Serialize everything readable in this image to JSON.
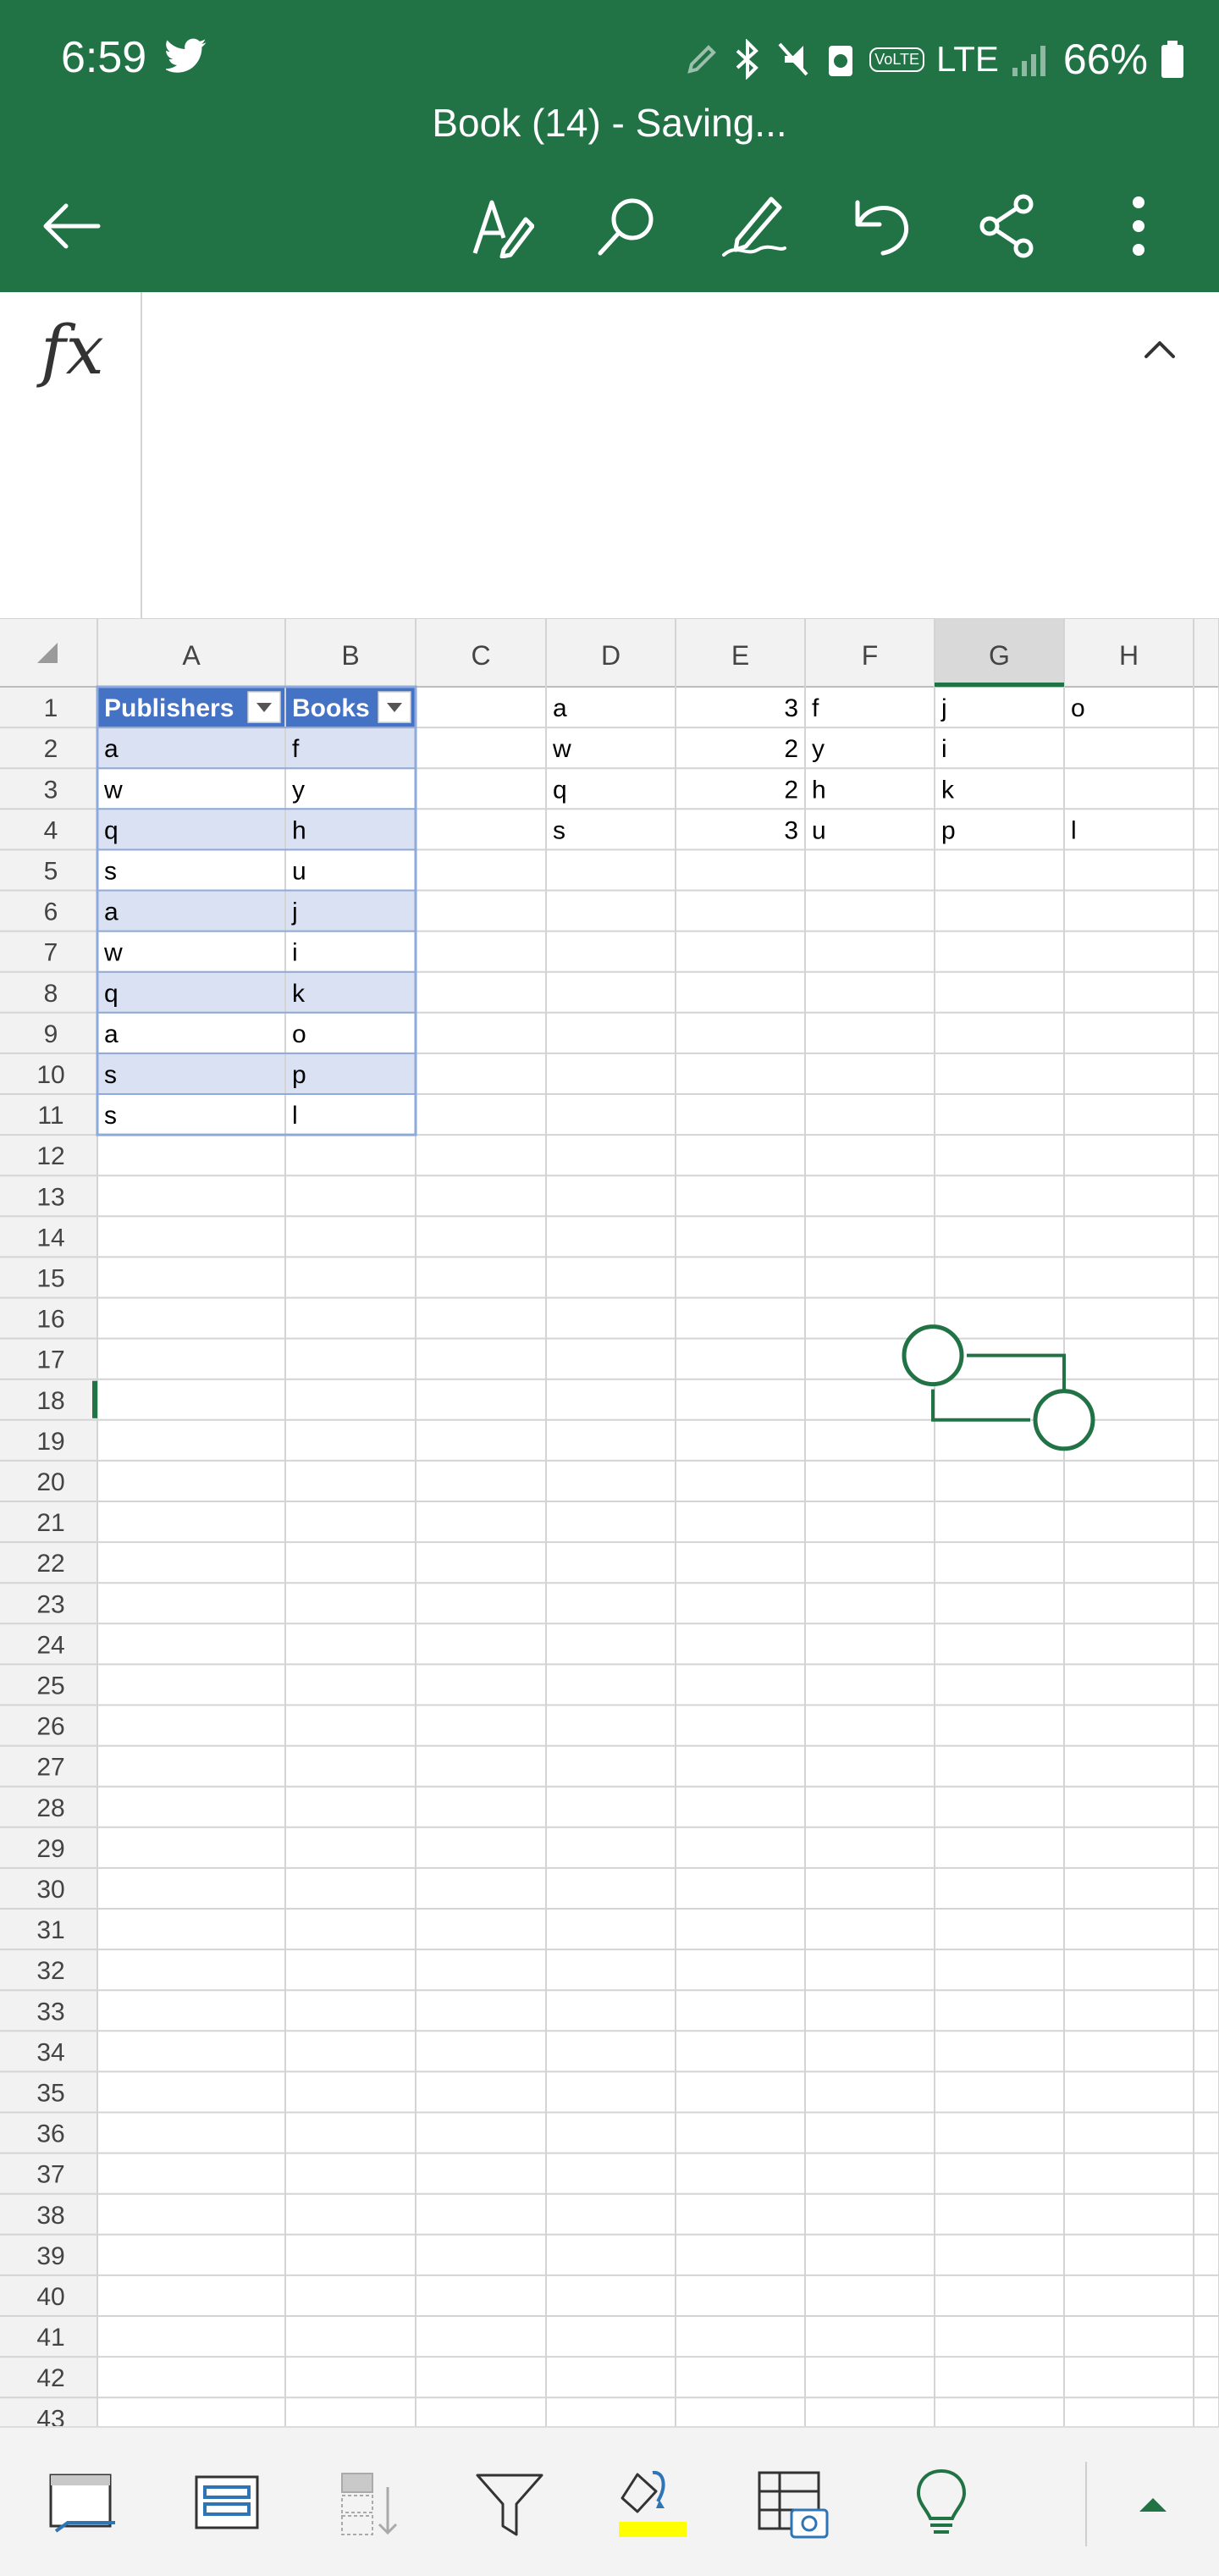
{
  "status": {
    "time": "6:59",
    "battery": "66%",
    "network": "LTE",
    "volte": "VoLTE"
  },
  "app": {
    "title": "Book (14) - Saving..."
  },
  "formula_bar": {
    "label": "fx",
    "value": ""
  },
  "sheet": {
    "column_headers": [
      "A",
      "B",
      "C",
      "D",
      "E",
      "F",
      "G",
      "H"
    ],
    "selected_column": "G",
    "selected_row": 18,
    "row_count": 43,
    "table": {
      "headers": [
        "Publishers",
        "Books"
      ],
      "rows": [
        [
          "a",
          "f"
        ],
        [
          "w",
          "y"
        ],
        [
          "q",
          "h"
        ],
        [
          "s",
          "u"
        ],
        [
          "a",
          "j"
        ],
        [
          "w",
          "i"
        ],
        [
          "q",
          "k"
        ],
        [
          "a",
          "o"
        ],
        [
          "s",
          "p"
        ],
        [
          "s",
          "l"
        ]
      ]
    },
    "cells": [
      {
        "ref": "D1",
        "value": "a"
      },
      {
        "ref": "E1",
        "value": "3"
      },
      {
        "ref": "F1",
        "value": "f"
      },
      {
        "ref": "G1",
        "value": "j"
      },
      {
        "ref": "H1",
        "value": "o"
      },
      {
        "ref": "D2",
        "value": "w"
      },
      {
        "ref": "E2",
        "value": "2"
      },
      {
        "ref": "F2",
        "value": "y"
      },
      {
        "ref": "G2",
        "value": "i"
      },
      {
        "ref": "D3",
        "value": "q"
      },
      {
        "ref": "E3",
        "value": "2"
      },
      {
        "ref": "F3",
        "value": "h"
      },
      {
        "ref": "G3",
        "value": "k"
      },
      {
        "ref": "D4",
        "value": "s"
      },
      {
        "ref": "E4",
        "value": "3"
      },
      {
        "ref": "F4",
        "value": "u"
      },
      {
        "ref": "G4",
        "value": "p"
      },
      {
        "ref": "H4",
        "value": "l"
      }
    ]
  },
  "colors": {
    "accent": "#217346",
    "table_header": "#4472c4",
    "table_band": "#d9e1f2",
    "table_border": "#8ea9db",
    "highlight_yellow": "#ffff00",
    "icon_blue": "#2e75b6"
  },
  "toolbar": {
    "icons": [
      "back-arrow-icon",
      "text-format-icon",
      "search-icon",
      "draw-pen-icon",
      "undo-icon",
      "share-icon",
      "more-options-icon"
    ]
  },
  "bottom_toolbar": {
    "icons": [
      "freeze-panes-icon",
      "table-style-icon",
      "insert-rows-icon",
      "filter-icon",
      "fill-color-icon",
      "insert-picture-icon",
      "ideas-lightbulb-icon",
      "expand-up-icon"
    ]
  }
}
